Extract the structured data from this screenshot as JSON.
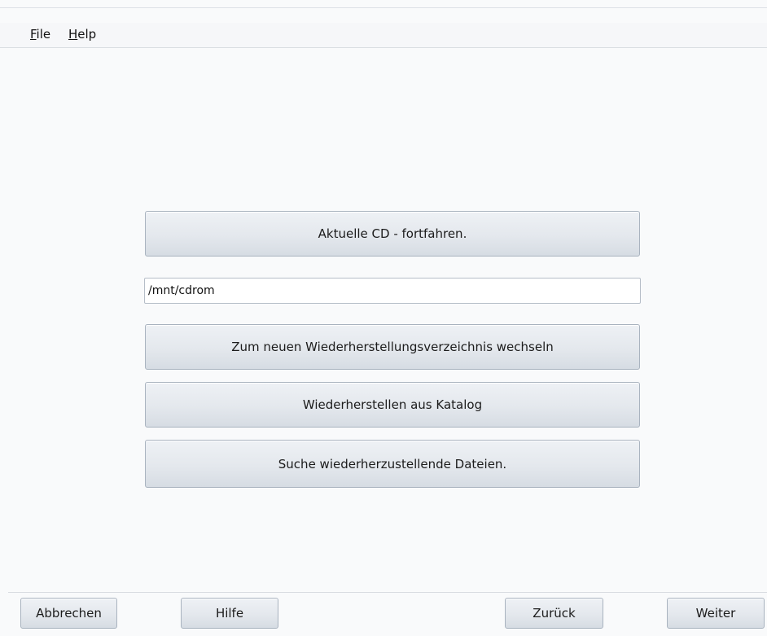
{
  "menubar": {
    "file": {
      "mnemonic": "F",
      "rest": "ile"
    },
    "help": {
      "mnemonic": "H",
      "rest": "elp"
    }
  },
  "main": {
    "continue_label": "Aktuelle CD - fortfahren.",
    "path_value": "/mnt/cdrom",
    "change_dir_label": "Zum neuen Wiederherstellungsverzeichnis wechseln",
    "restore_catalog_label": "Wiederherstellen aus Katalog",
    "search_files_label": "Suche wiederherzustellende Dateien."
  },
  "footer": {
    "cancel_label": "Abbrechen",
    "help_label": "Hilfe",
    "back_label": "Zurück",
    "next_label": "Weiter"
  }
}
